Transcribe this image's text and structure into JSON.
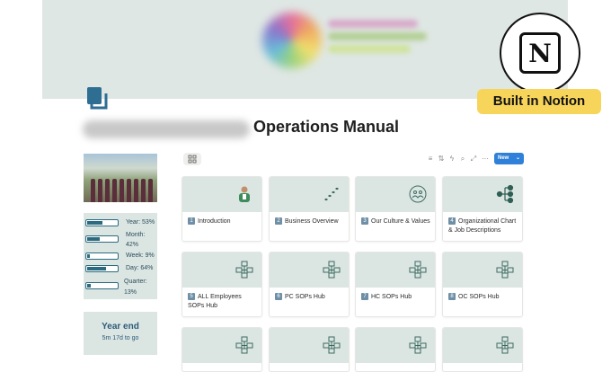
{
  "page": {
    "title": "Operations Manual"
  },
  "badge": {
    "logo_letter": "N",
    "label": "Built in Notion"
  },
  "progress": [
    {
      "label": "Year: 53%",
      "value": 0.53
    },
    {
      "label": "Month: 42%",
      "value": 0.42
    },
    {
      "label": "Week: 9%",
      "value": 0.09
    },
    {
      "label": "Day: 64%",
      "value": 0.64
    },
    {
      "label": "Quarter: 13%",
      "value": 0.13
    }
  ],
  "countdown": {
    "title": "Year end",
    "remaining": "5m 17d to go"
  },
  "toolbar": {
    "new_label": "New",
    "tools": [
      "filter-icon",
      "sort-icon",
      "lightning-icon",
      "search-icon",
      "link-icon",
      "more-icon"
    ]
  },
  "cards": [
    {
      "num": "1",
      "title": "Introduction",
      "icon": "person-icon"
    },
    {
      "num": "2",
      "title": "Business Overview",
      "icon": "footsteps-icon"
    },
    {
      "num": "3",
      "title": "Our Culture & Values",
      "icon": "team-icon"
    },
    {
      "num": "4",
      "title": "Organizational Chart & Job Descriptions",
      "icon": "org-chart-icon"
    },
    {
      "num": "5",
      "title": "ALL Employees SOPs Hub",
      "icon": "hub-icon"
    },
    {
      "num": "6",
      "title": "PC SOPs Hub",
      "icon": "hub-icon"
    },
    {
      "num": "7",
      "title": "HC SOPs Hub",
      "icon": "hub-icon"
    },
    {
      "num": "8",
      "title": "OC SOPs Hub",
      "icon": "hub-icon"
    },
    {
      "num": "",
      "title": "",
      "icon": "hub-icon"
    },
    {
      "num": "",
      "title": "",
      "icon": "hub-icon"
    },
    {
      "num": "",
      "title": "",
      "icon": "hub-icon"
    },
    {
      "num": "",
      "title": "",
      "icon": "hub-icon"
    }
  ]
}
